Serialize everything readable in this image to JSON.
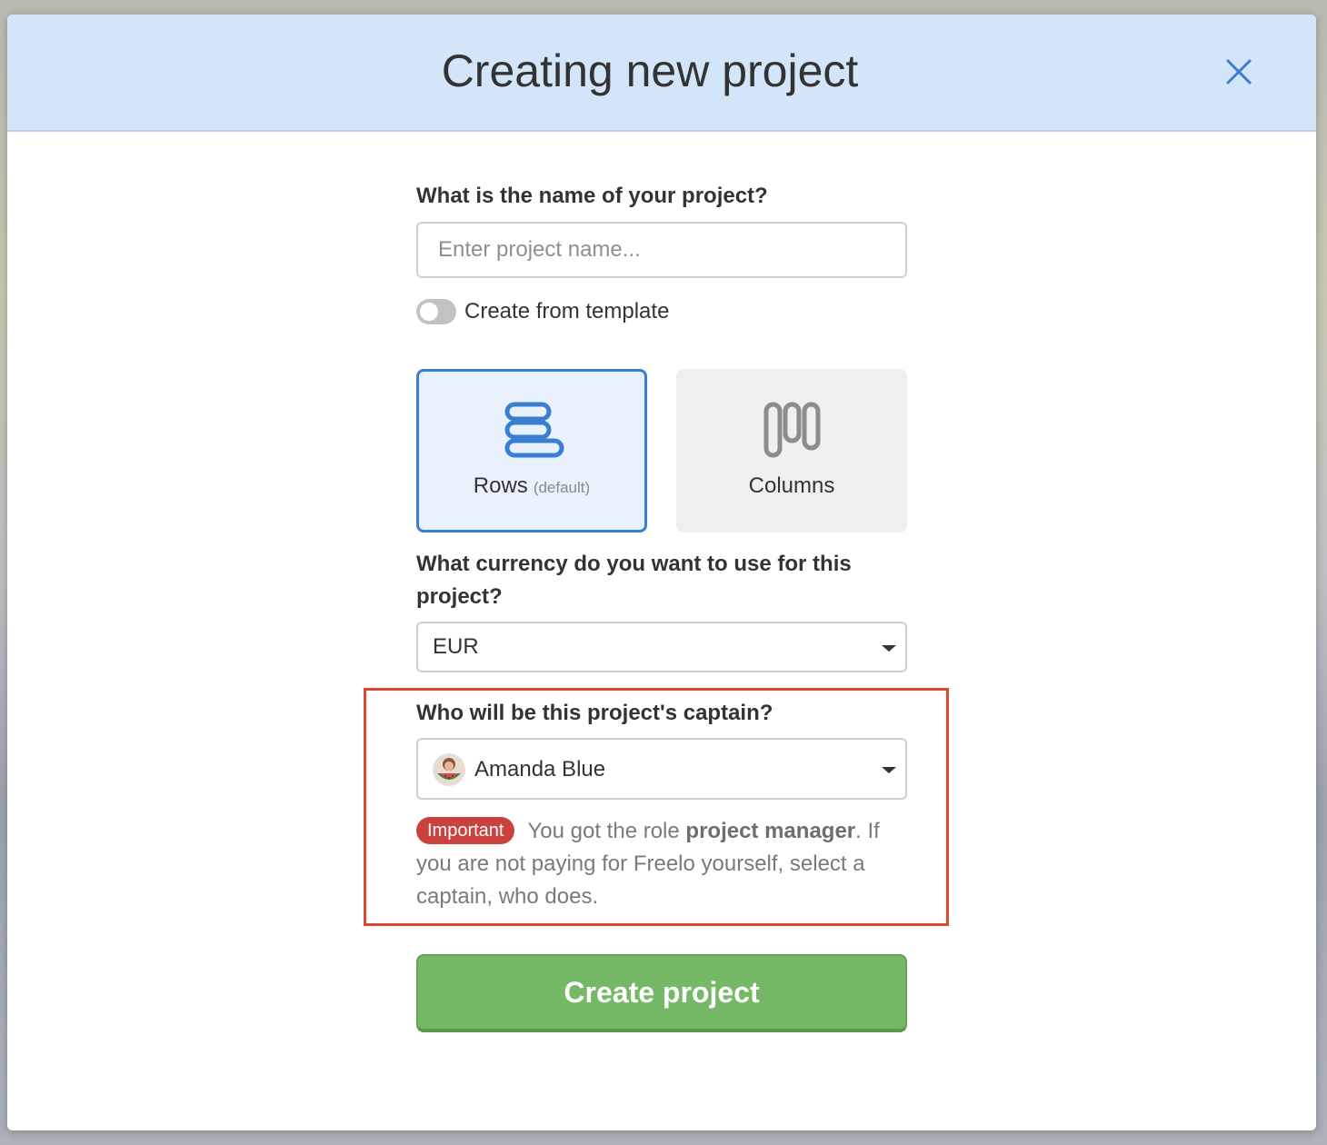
{
  "dialog": {
    "title": "Creating new project",
    "close_icon": "close-icon"
  },
  "project_name": {
    "label": "What is the name of your project?",
    "placeholder": "Enter project name...",
    "value": ""
  },
  "template_toggle": {
    "label": "Create from template",
    "enabled": false
  },
  "view_options": {
    "rows": {
      "label": "Rows",
      "sublabel": "(default)",
      "icon": "rows-icon",
      "selected": true
    },
    "columns": {
      "label": "Columns",
      "icon": "columns-icon",
      "selected": false
    }
  },
  "currency": {
    "label": "What currency do you want to use for this project?",
    "selected": "EUR"
  },
  "captain": {
    "label": "Who will be this project's captain?",
    "selected": "Amanda Blue",
    "avatar_icon": "user-avatar"
  },
  "notice": {
    "badge": "Important",
    "text_before": "You got the role ",
    "role": "project manager",
    "text_after": ". If you are not paying for Freelo yourself, select a captain, who does."
  },
  "submit": {
    "label": "Create project"
  },
  "colors": {
    "header_bg": "#d3e5f8",
    "accent_blue": "#3a7ed2",
    "highlight_red": "#df4a2f",
    "badge_red": "#c9423d",
    "button_green": "#75b866"
  }
}
